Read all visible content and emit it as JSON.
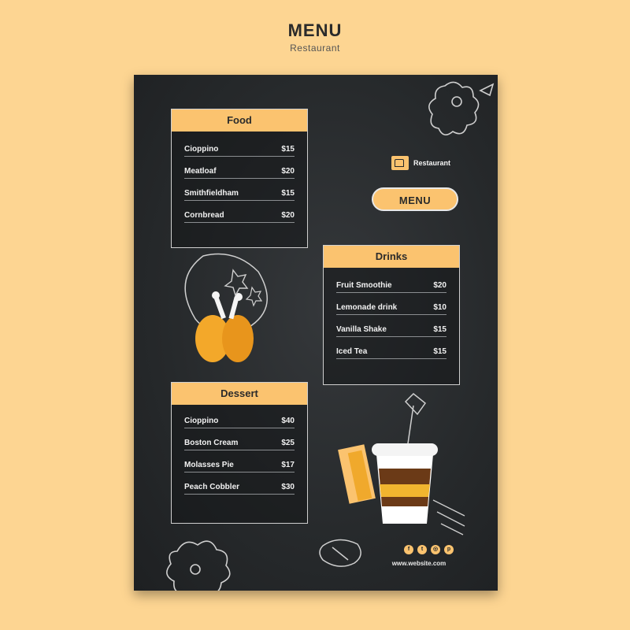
{
  "header": {
    "title": "MENU",
    "subtitle": "Restaurant"
  },
  "brand": {
    "name": "Restaurant",
    "logo_icon": "storefront-icon"
  },
  "menu_button": {
    "label": "MENU"
  },
  "food": {
    "title": "Food",
    "items": [
      {
        "name": "Cioppino",
        "price": "$15"
      },
      {
        "name": "Meatloaf",
        "price": "$20"
      },
      {
        "name": "Smithfieldham",
        "price": "$15"
      },
      {
        "name": "Cornbread",
        "price": "$20"
      }
    ]
  },
  "drinks": {
    "title": "Drinks",
    "items": [
      {
        "name": "Fruit Smoothie",
        "price": "$20"
      },
      {
        "name": "Lemonade drink",
        "price": "$10"
      },
      {
        "name": "Vanilla Shake",
        "price": "$15"
      },
      {
        "name": "Iced Tea",
        "price": "$15"
      }
    ]
  },
  "dessert": {
    "title": "Dessert",
    "items": [
      {
        "name": "Cioppino",
        "price": "$40"
      },
      {
        "name": "Boston Cream",
        "price": "$25"
      },
      {
        "name": "Molasses Pie",
        "price": "$17"
      },
      {
        "name": "Peach Cobbler",
        "price": "$30"
      }
    ]
  },
  "socials": [
    {
      "icon": "facebook-icon",
      "glyph": "f"
    },
    {
      "icon": "twitter-icon",
      "glyph": "t"
    },
    {
      "icon": "instagram-icon",
      "glyph": "◎"
    },
    {
      "icon": "pinterest-icon",
      "glyph": "p"
    }
  ],
  "website": "www.website.com",
  "colors": {
    "background": "#fdd592",
    "accent": "#fbc36f",
    "board": "#26292b"
  }
}
